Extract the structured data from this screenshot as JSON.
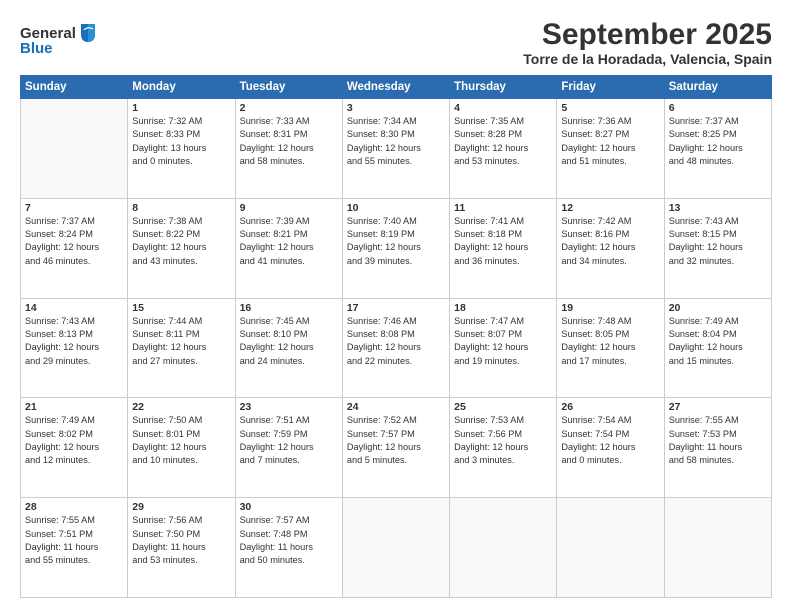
{
  "logo": {
    "general": "General",
    "blue": "Blue"
  },
  "header": {
    "title": "September 2025",
    "location": "Torre de la Horadada, Valencia, Spain"
  },
  "weekdays": [
    "Sunday",
    "Monday",
    "Tuesday",
    "Wednesday",
    "Thursday",
    "Friday",
    "Saturday"
  ],
  "weeks": [
    [
      {
        "day": "",
        "content": ""
      },
      {
        "day": "1",
        "content": "Sunrise: 7:32 AM\nSunset: 8:33 PM\nDaylight: 13 hours\nand 0 minutes."
      },
      {
        "day": "2",
        "content": "Sunrise: 7:33 AM\nSunset: 8:31 PM\nDaylight: 12 hours\nand 58 minutes."
      },
      {
        "day": "3",
        "content": "Sunrise: 7:34 AM\nSunset: 8:30 PM\nDaylight: 12 hours\nand 55 minutes."
      },
      {
        "day": "4",
        "content": "Sunrise: 7:35 AM\nSunset: 8:28 PM\nDaylight: 12 hours\nand 53 minutes."
      },
      {
        "day": "5",
        "content": "Sunrise: 7:36 AM\nSunset: 8:27 PM\nDaylight: 12 hours\nand 51 minutes."
      },
      {
        "day": "6",
        "content": "Sunrise: 7:37 AM\nSunset: 8:25 PM\nDaylight: 12 hours\nand 48 minutes."
      }
    ],
    [
      {
        "day": "7",
        "content": "Sunrise: 7:37 AM\nSunset: 8:24 PM\nDaylight: 12 hours\nand 46 minutes."
      },
      {
        "day": "8",
        "content": "Sunrise: 7:38 AM\nSunset: 8:22 PM\nDaylight: 12 hours\nand 43 minutes."
      },
      {
        "day": "9",
        "content": "Sunrise: 7:39 AM\nSunset: 8:21 PM\nDaylight: 12 hours\nand 41 minutes."
      },
      {
        "day": "10",
        "content": "Sunrise: 7:40 AM\nSunset: 8:19 PM\nDaylight: 12 hours\nand 39 minutes."
      },
      {
        "day": "11",
        "content": "Sunrise: 7:41 AM\nSunset: 8:18 PM\nDaylight: 12 hours\nand 36 minutes."
      },
      {
        "day": "12",
        "content": "Sunrise: 7:42 AM\nSunset: 8:16 PM\nDaylight: 12 hours\nand 34 minutes."
      },
      {
        "day": "13",
        "content": "Sunrise: 7:43 AM\nSunset: 8:15 PM\nDaylight: 12 hours\nand 32 minutes."
      }
    ],
    [
      {
        "day": "14",
        "content": "Sunrise: 7:43 AM\nSunset: 8:13 PM\nDaylight: 12 hours\nand 29 minutes."
      },
      {
        "day": "15",
        "content": "Sunrise: 7:44 AM\nSunset: 8:11 PM\nDaylight: 12 hours\nand 27 minutes."
      },
      {
        "day": "16",
        "content": "Sunrise: 7:45 AM\nSunset: 8:10 PM\nDaylight: 12 hours\nand 24 minutes."
      },
      {
        "day": "17",
        "content": "Sunrise: 7:46 AM\nSunset: 8:08 PM\nDaylight: 12 hours\nand 22 minutes."
      },
      {
        "day": "18",
        "content": "Sunrise: 7:47 AM\nSunset: 8:07 PM\nDaylight: 12 hours\nand 19 minutes."
      },
      {
        "day": "19",
        "content": "Sunrise: 7:48 AM\nSunset: 8:05 PM\nDaylight: 12 hours\nand 17 minutes."
      },
      {
        "day": "20",
        "content": "Sunrise: 7:49 AM\nSunset: 8:04 PM\nDaylight: 12 hours\nand 15 minutes."
      }
    ],
    [
      {
        "day": "21",
        "content": "Sunrise: 7:49 AM\nSunset: 8:02 PM\nDaylight: 12 hours\nand 12 minutes."
      },
      {
        "day": "22",
        "content": "Sunrise: 7:50 AM\nSunset: 8:01 PM\nDaylight: 12 hours\nand 10 minutes."
      },
      {
        "day": "23",
        "content": "Sunrise: 7:51 AM\nSunset: 7:59 PM\nDaylight: 12 hours\nand 7 minutes."
      },
      {
        "day": "24",
        "content": "Sunrise: 7:52 AM\nSunset: 7:57 PM\nDaylight: 12 hours\nand 5 minutes."
      },
      {
        "day": "25",
        "content": "Sunrise: 7:53 AM\nSunset: 7:56 PM\nDaylight: 12 hours\nand 3 minutes."
      },
      {
        "day": "26",
        "content": "Sunrise: 7:54 AM\nSunset: 7:54 PM\nDaylight: 12 hours\nand 0 minutes."
      },
      {
        "day": "27",
        "content": "Sunrise: 7:55 AM\nSunset: 7:53 PM\nDaylight: 11 hours\nand 58 minutes."
      }
    ],
    [
      {
        "day": "28",
        "content": "Sunrise: 7:55 AM\nSunset: 7:51 PM\nDaylight: 11 hours\nand 55 minutes."
      },
      {
        "day": "29",
        "content": "Sunrise: 7:56 AM\nSunset: 7:50 PM\nDaylight: 11 hours\nand 53 minutes."
      },
      {
        "day": "30",
        "content": "Sunrise: 7:57 AM\nSunset: 7:48 PM\nDaylight: 11 hours\nand 50 minutes."
      },
      {
        "day": "",
        "content": ""
      },
      {
        "day": "",
        "content": ""
      },
      {
        "day": "",
        "content": ""
      },
      {
        "day": "",
        "content": ""
      }
    ]
  ]
}
